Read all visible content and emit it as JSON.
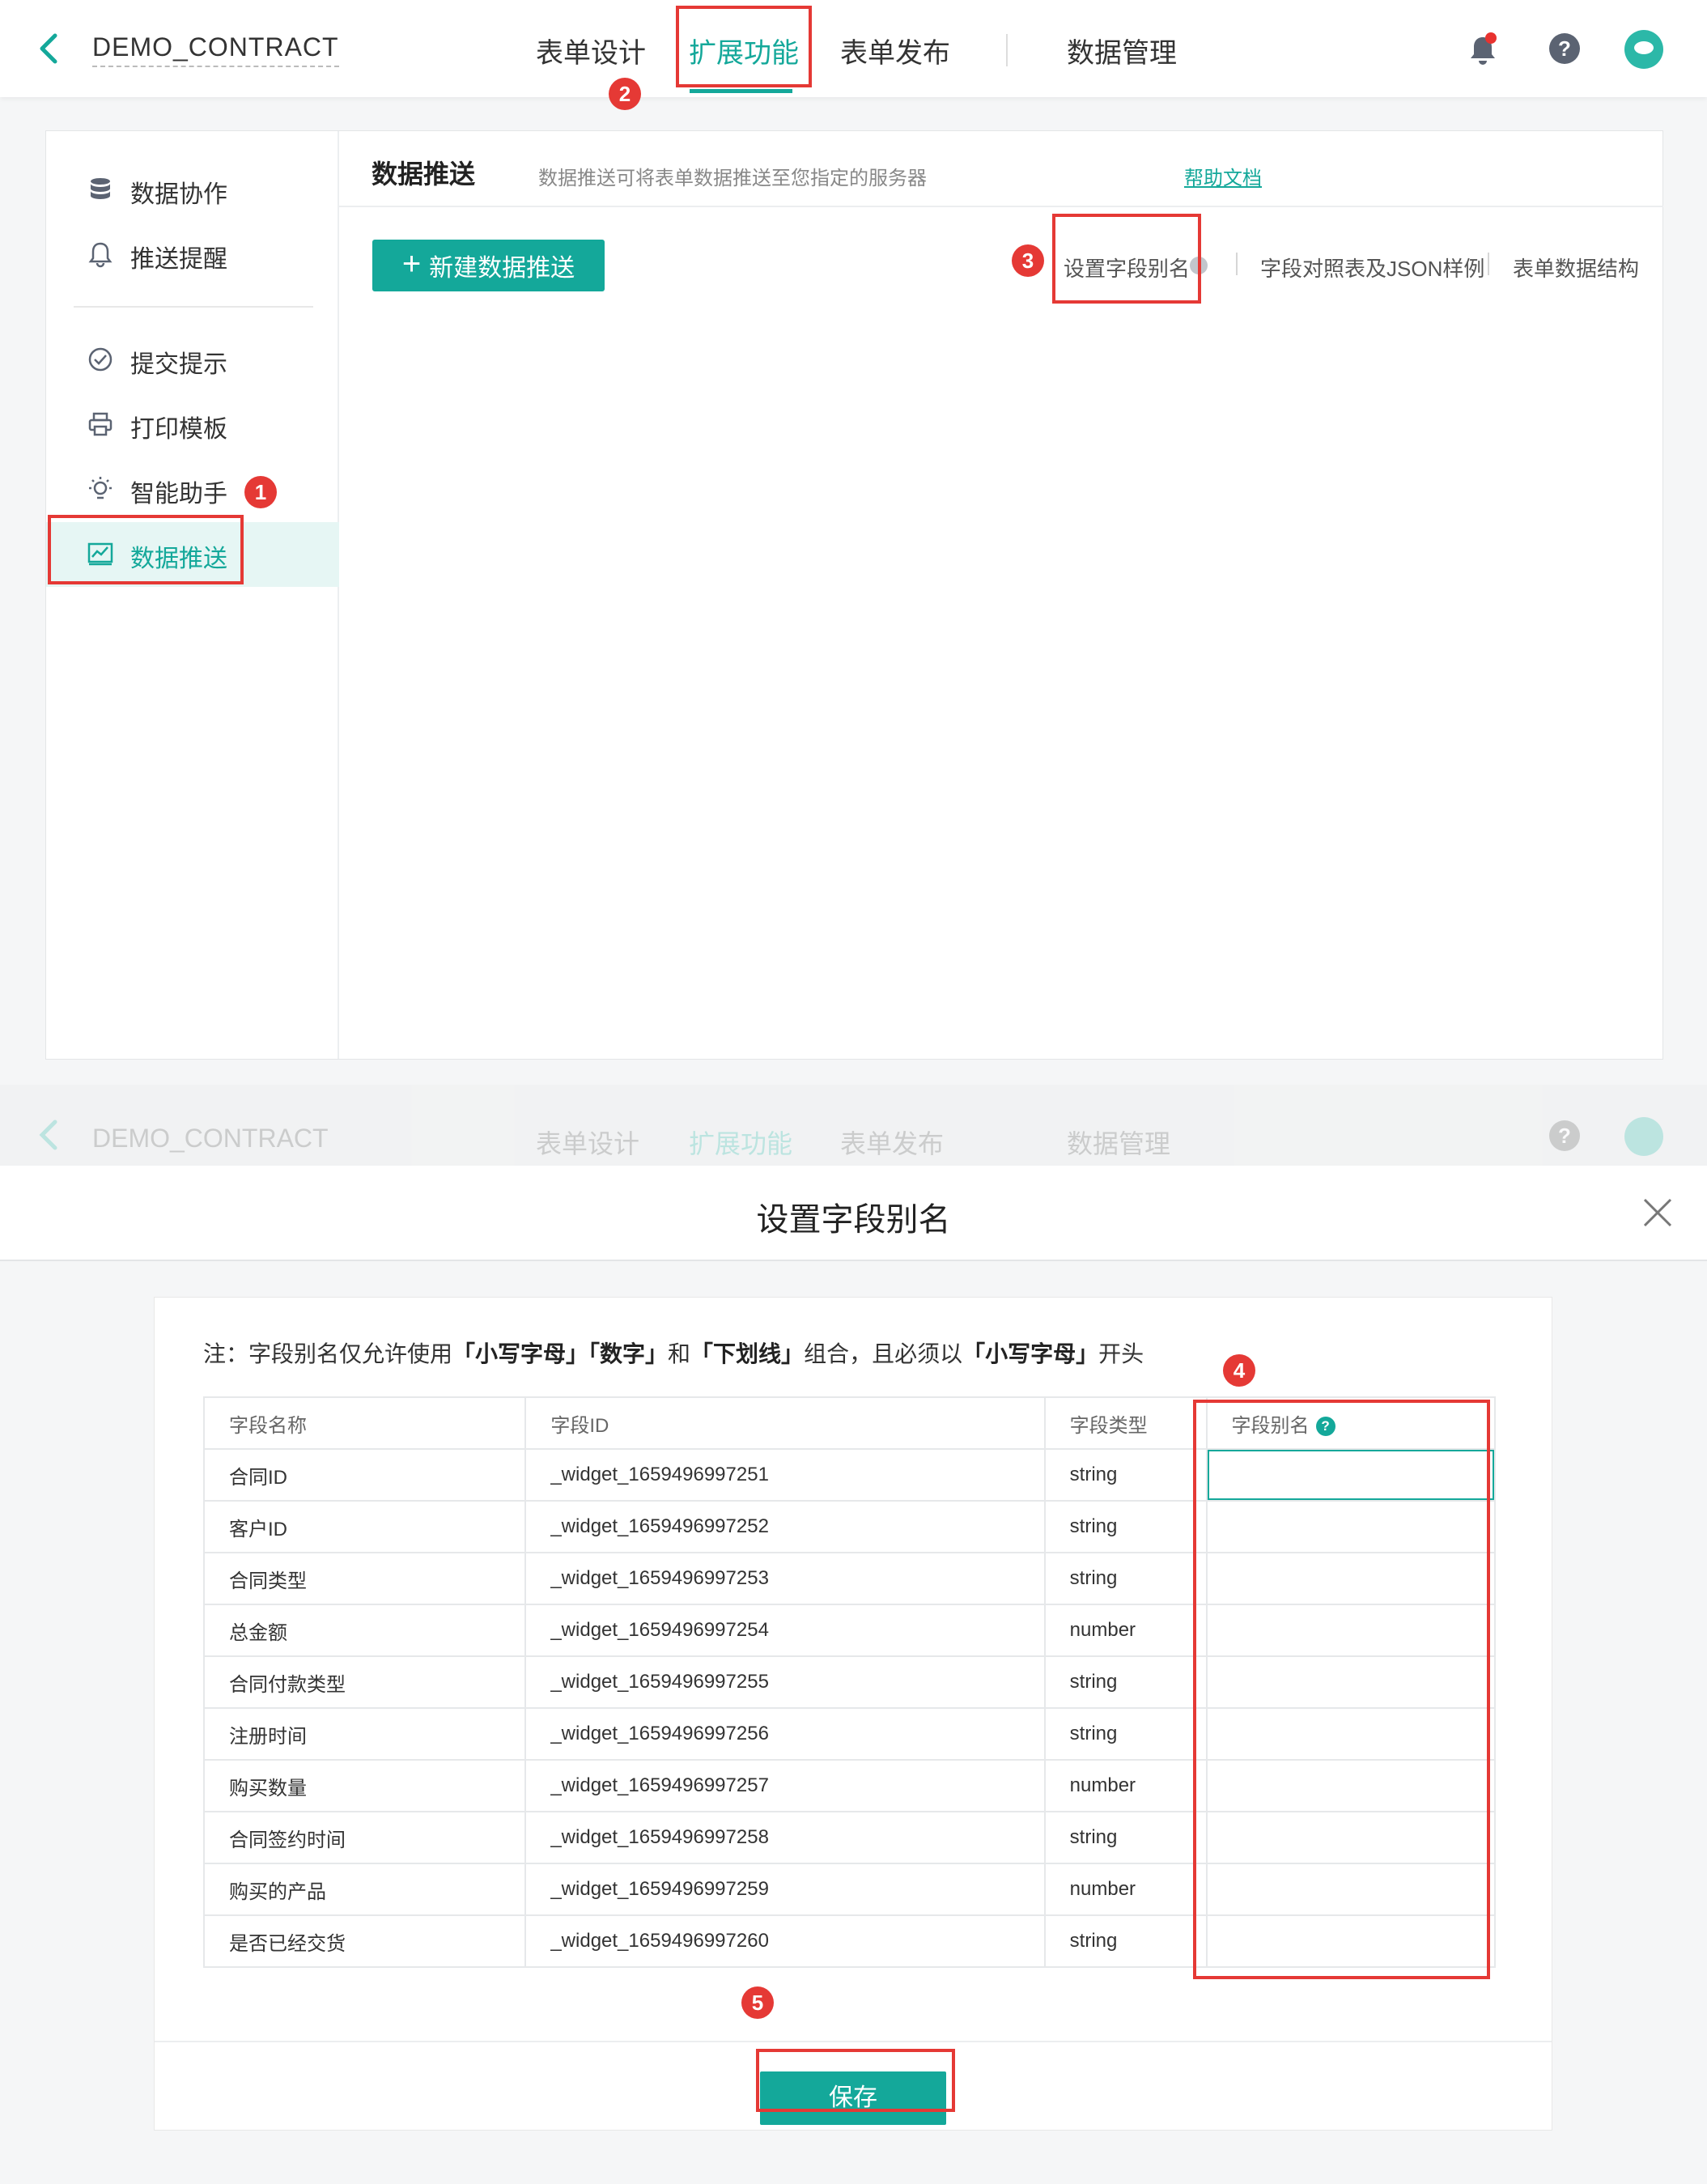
{
  "header": {
    "app_title": "DEMO_CONTRACT",
    "tabs": [
      {
        "label": "表单设计"
      },
      {
        "label": "扩展功能"
      },
      {
        "label": "表单发布"
      },
      {
        "label": "数据管理"
      }
    ],
    "active_tab": "扩展功能"
  },
  "sidebar": {
    "items": [
      {
        "label": "数据协作",
        "icon": "database-icon"
      },
      {
        "label": "推送提醒",
        "icon": "bell-icon"
      },
      {
        "label": "提交提示",
        "icon": "check-circle-icon"
      },
      {
        "label": "打印模板",
        "icon": "printer-icon"
      },
      {
        "label": "智能助手",
        "icon": "bulb-icon"
      },
      {
        "label": "数据推送",
        "icon": "chart-icon"
      }
    ],
    "active": "数据推送"
  },
  "main": {
    "title": "数据推送",
    "description": "数据推送可将表单数据推送至您指定的服务器",
    "help_link": "帮助文档",
    "new_button": "新建数据推送",
    "links": [
      "设置字段别名",
      "字段对照表及JSON样例",
      "表单数据结构"
    ]
  },
  "annotations": [
    "1",
    "2",
    "3",
    "4",
    "5"
  ],
  "modal": {
    "title": "设置字段别名",
    "note_prefix": "注：字段别名仅允许使用",
    "note_t1": "「小写字母」「数字」",
    "note_and": "和",
    "note_t2": "「下划线」",
    "note_mid": "组合，且必须以",
    "note_t3": "「小写字母」",
    "note_end": "开头",
    "columns": [
      "字段名称",
      "字段ID",
      "字段类型",
      "字段别名"
    ],
    "rows": [
      {
        "name": "合同ID",
        "id": "_widget_1659496997251",
        "type": "string",
        "alias": ""
      },
      {
        "name": "客户ID",
        "id": "_widget_1659496997252",
        "type": "string",
        "alias": ""
      },
      {
        "name": "合同类型",
        "id": "_widget_1659496997253",
        "type": "string",
        "alias": ""
      },
      {
        "name": "总金额",
        "id": "_widget_1659496997254",
        "type": "number",
        "alias": ""
      },
      {
        "name": "合同付款类型",
        "id": "_widget_1659496997255",
        "type": "string",
        "alias": ""
      },
      {
        "name": "注册时间",
        "id": "_widget_1659496997256",
        "type": "string",
        "alias": ""
      },
      {
        "name": "购买数量",
        "id": "_widget_1659496997257",
        "type": "number",
        "alias": ""
      },
      {
        "name": "合同签约时间",
        "id": "_widget_1659496997258",
        "type": "string",
        "alias": ""
      },
      {
        "name": "购买的产品",
        "id": "_widget_1659496997259",
        "type": "number",
        "alias": ""
      },
      {
        "name": "是否已经交货",
        "id": "_widget_1659496997260",
        "type": "string",
        "alias": ""
      }
    ],
    "save_button": "保存"
  },
  "colors": {
    "accent": "#14a89a",
    "annotation": "#e53935"
  }
}
